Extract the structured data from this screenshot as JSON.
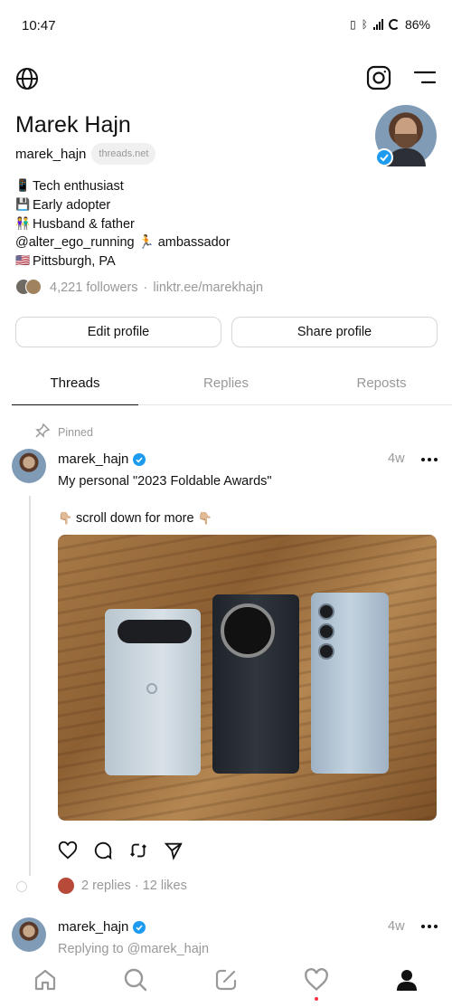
{
  "status": {
    "time": "10:47",
    "battery": "86%"
  },
  "profile": {
    "name": "Marek Hajn",
    "handle": "marek_hajn",
    "domain_chip": "threads.net",
    "bio": [
      {
        "icon": "📱",
        "icon_name": "mobile-phone-icon",
        "text": "Tech enthusiast"
      },
      {
        "icon": "💾",
        "icon_name": "floppy-disk-icon",
        "text": "Early adopter"
      },
      {
        "icon": "👫",
        "icon_name": "couple-icon",
        "text": "Husband & father"
      },
      {
        "icon": "",
        "icon_name": "",
        "text": "@alter_ego_running 🏃 ambassador"
      },
      {
        "icon": "🇺🇸",
        "icon_name": "us-flag-icon",
        "text": "Pittsburgh, PA"
      }
    ],
    "followers": "4,221 followers",
    "link": "linktr.ee/marekhajn",
    "separator": "·"
  },
  "buttons": {
    "edit": "Edit profile",
    "share": "Share profile"
  },
  "tabs": [
    {
      "label": "Threads",
      "active": true
    },
    {
      "label": "Replies",
      "active": false
    },
    {
      "label": "Reposts",
      "active": false
    }
  ],
  "posts": [
    {
      "pinned_label": "Pinned",
      "author": "marek_hajn",
      "time": "4w",
      "text": "My personal \"2023 Foldable Awards\"",
      "subtext": "scroll down for more",
      "subtext_emoji": "👇🏼",
      "replies_likes": "2 replies · 12 likes"
    },
    {
      "author": "marek_hajn",
      "time": "4w",
      "text": "Replying to @marek_hajn"
    }
  ],
  "colors": {
    "verified": "#1d9bf0",
    "muted": "#999999",
    "notification_dot": "#ff3040"
  }
}
